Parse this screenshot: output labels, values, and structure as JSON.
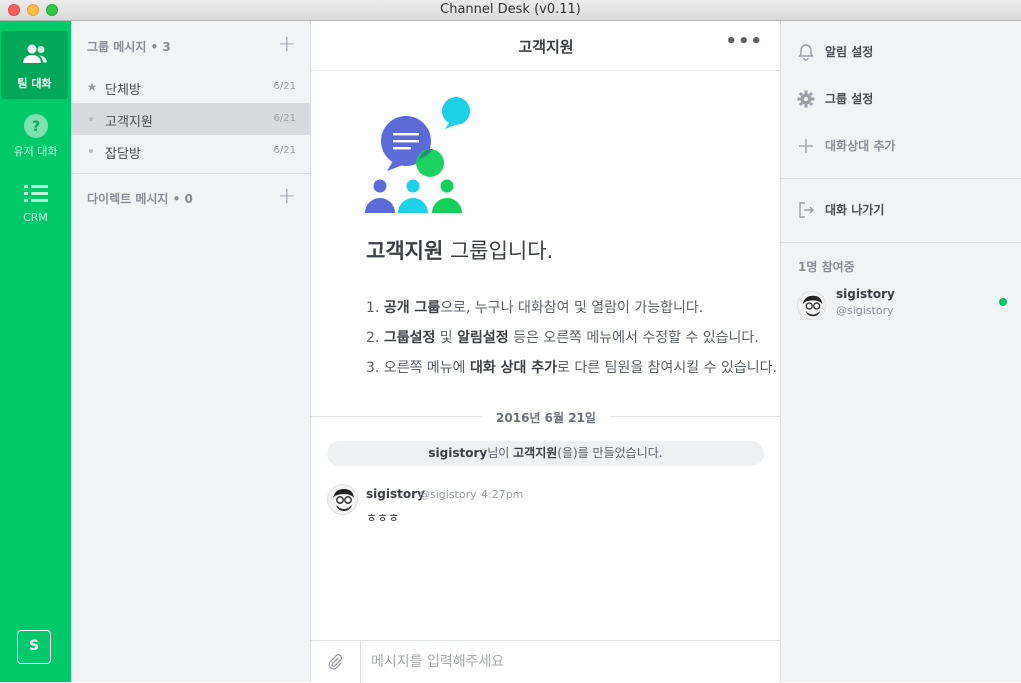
{
  "window": {
    "title": "Channel Desk (v0.11)"
  },
  "rail": {
    "items": [
      {
        "label": "팀 대화",
        "icon": "team-icon",
        "active": true
      },
      {
        "label": "유저 대화",
        "icon": "question-icon",
        "active": false
      },
      {
        "label": "CRM",
        "icon": "list-icon",
        "active": false
      }
    ],
    "bottom_badge": "S"
  },
  "channels": {
    "group_header": "그룹 메시지 • 3",
    "groups": [
      {
        "name": "단체방",
        "date": "6/21",
        "icon": "star-icon",
        "selected": false
      },
      {
        "name": "고객지원",
        "date": "6/21",
        "icon": "dot",
        "selected": true
      },
      {
        "name": "잡담방",
        "date": "6/21",
        "icon": "dot",
        "selected": false
      }
    ],
    "direct_header": "다이렉트 메시지 • 0"
  },
  "main": {
    "title": "고객지원",
    "more_label": "•••",
    "intro": {
      "title_bold": "고객지원",
      "title_rest": " 그룹입니다.",
      "line1": {
        "pre": "1. ",
        "bold": "공개 그룹",
        "post": "으로, 누구나 대화참여 및 열람이 가능합니다."
      },
      "line2": {
        "pre": "2. ",
        "bold": "그룹설정",
        "mid": " 및 ",
        "bold2": "알림설정",
        "post": " 등은 오른쪽 메뉴에서 수정할 수 있습니다."
      },
      "line3": {
        "pre": "3. 오른쪽 메뉴에 ",
        "bold": "대화 상대 추가",
        "post": "로 다른 팀원을 참여시킬 수 있습니다."
      }
    },
    "date_separator": "2016년 6월 21일",
    "system_message": {
      "user": "sigistory",
      "mid": "님이 ",
      "group": "고객지원",
      "post": "(을)를 만들었습니다."
    },
    "messages": [
      {
        "name": "sigistory",
        "handle": "@sigistory",
        "time": "4:27pm",
        "text": "ㅎㅎㅎ"
      }
    ],
    "composer": {
      "placeholder": "메시지를 입력해주세요"
    }
  },
  "rpanel": {
    "items": [
      {
        "label": "알림 설정",
        "icon": "bell-icon"
      },
      {
        "label": "그룹 설정",
        "icon": "gear-icon"
      },
      {
        "label": "대화상대 추가",
        "icon": "plus-icon"
      },
      {
        "label": "대화 나가기",
        "icon": "exit-icon"
      }
    ],
    "participants_count": "1명 참여중",
    "participants": [
      {
        "name": "sigistory",
        "handle": "@sigistory",
        "online": true
      }
    ]
  },
  "colors": {
    "brand_green": "#00c96a",
    "brand_green_dark": "#00a857",
    "purple": "#5c6bd8",
    "cyan": "#1dd1e6",
    "green": "#12d05a"
  }
}
